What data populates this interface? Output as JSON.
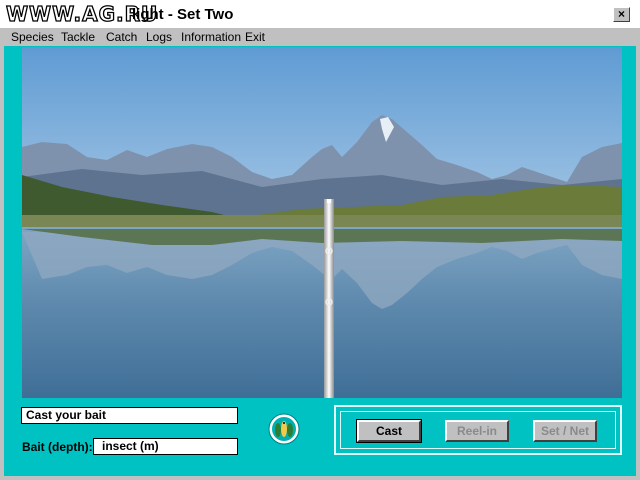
{
  "window": {
    "watermark": "WWW.AG.RU",
    "title": "light - Set Two",
    "close_label": "×"
  },
  "menu": {
    "items": [
      "Species",
      "Tackle",
      "Catch",
      "Logs",
      "Information",
      "Exit"
    ]
  },
  "status": {
    "message": "Cast your bait"
  },
  "bait": {
    "label": "Bait (depth):",
    "value": "insect (m)"
  },
  "buttons": {
    "cast": "Cast",
    "reel_in": "Reel-in",
    "set_net": "Set / Net"
  },
  "colors": {
    "panel": "#00c2c2",
    "sky": "#6fa6d8",
    "water": "#4d7ea6"
  },
  "icons": {
    "species": "fish-species-icon"
  }
}
